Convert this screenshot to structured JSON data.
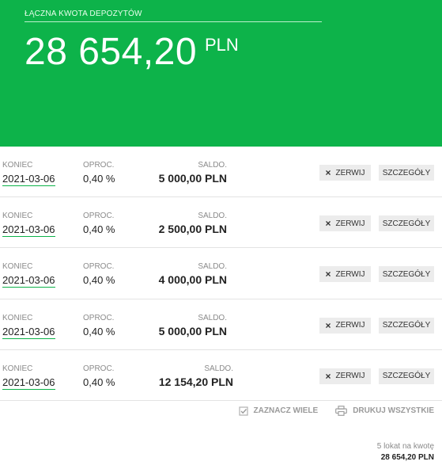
{
  "header": {
    "label": "ŁĄCZNA KWOTA DEPOZYTÓW",
    "amount": "28 654,20",
    "currency": "PLN"
  },
  "columns": {
    "end": "KONIEC",
    "rate": "OPROC.",
    "balance": "SALDO."
  },
  "deposits": [
    {
      "end_date": "2021-03-06",
      "rate": "0,40 %",
      "balance": "5 000,00 PLN"
    },
    {
      "end_date": "2021-03-06",
      "rate": "0,40 %",
      "balance": "2 500,00 PLN"
    },
    {
      "end_date": "2021-03-06",
      "rate": "0,40 %",
      "balance": "4 000,00 PLN"
    },
    {
      "end_date": "2021-03-06",
      "rate": "0,40 %",
      "balance": "5 000,00 PLN"
    },
    {
      "end_date": "2021-03-06",
      "rate": "0,40 %",
      "balance": "12 154,20 PLN"
    }
  ],
  "buttons": {
    "break_label": "ZERWIJ",
    "details_label": "SZCZEGÓŁY"
  },
  "actions": {
    "select_many": "ZAZNACZ WIELE",
    "print_all": "DRUKUJ WSZYSTKIE"
  },
  "summary": {
    "count_text": "5 lokat na kwotę",
    "total": "28 654,20 PLN"
  },
  "colors": {
    "brand_green": "#0db34a",
    "button_bg": "#ececec"
  }
}
